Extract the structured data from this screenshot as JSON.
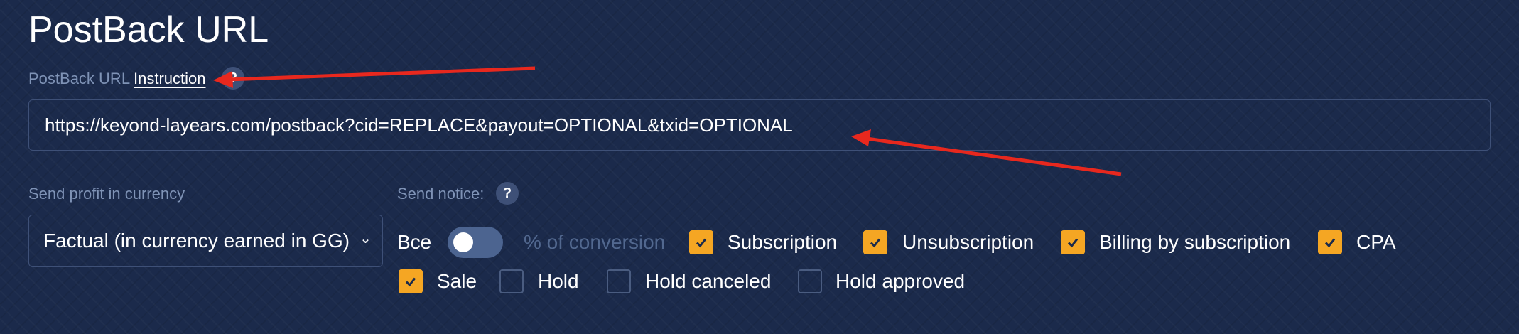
{
  "page": {
    "title": "PostBack URL"
  },
  "postback": {
    "label": "PostBack URL",
    "instruction_link": "Instruction",
    "help": "?",
    "url_value": "https://keyond-layears.com/postback?cid=REPLACE&payout=OPTIONAL&txid=OPTIONAL"
  },
  "currency": {
    "label": "Send profit in currency",
    "selected": "Factual (in currency earned in GG)"
  },
  "notice": {
    "label": "Send notice:",
    "help": "?",
    "toggle_label": "Все",
    "toggle_on": false,
    "toggle_hint": "% of conversion",
    "options": [
      {
        "label": "Subscription",
        "checked": true
      },
      {
        "label": "Unsubscription",
        "checked": true
      },
      {
        "label": "Billing by subscription",
        "checked": true
      },
      {
        "label": "CPA",
        "checked": true
      },
      {
        "label": "Sale",
        "checked": true
      },
      {
        "label": "Hold",
        "checked": false
      },
      {
        "label": "Hold canceled",
        "checked": false
      },
      {
        "label": "Hold approved",
        "checked": false
      }
    ]
  },
  "colors": {
    "background": "#1b2a4b",
    "accent": "#f5a623",
    "muted_text": "#7f93b6",
    "annotation_arrow": "#e8281e"
  }
}
